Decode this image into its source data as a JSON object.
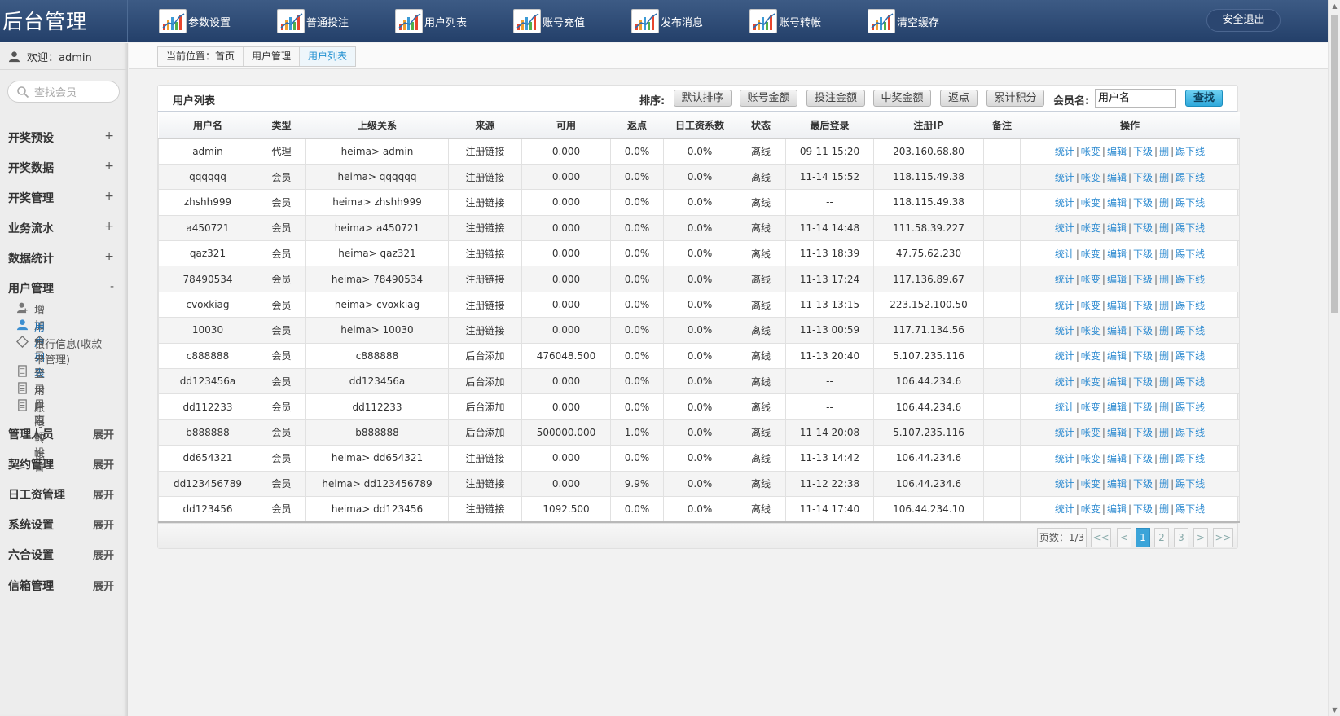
{
  "app": {
    "title": "后台管理",
    "logout_label": "安全退出"
  },
  "nav": [
    {
      "label": "参数设置"
    },
    {
      "label": "普通投注"
    },
    {
      "label": "用户列表"
    },
    {
      "label": "账号充值"
    },
    {
      "label": "发布消息"
    },
    {
      "label": "账号转帐"
    },
    {
      "label": "清空缓存"
    }
  ],
  "sidebar": {
    "welcome": "欢迎：admin",
    "search_placeholder": "查找会员",
    "menus": [
      {
        "label": "开奖预设",
        "sign": "+"
      },
      {
        "label": "开奖数据",
        "sign": "+"
      },
      {
        "label": "开奖管理",
        "sign": "+"
      },
      {
        "label": "业务流水",
        "sign": "+"
      },
      {
        "label": "数据统计",
        "sign": "+"
      },
      {
        "label": "用户管理",
        "sign": "-"
      },
      {
        "label": "管理人员",
        "sign": "展开"
      },
      {
        "label": "契约管理",
        "sign": "展开"
      },
      {
        "label": "日工资管理",
        "sign": "展开"
      },
      {
        "label": "系统设置",
        "sign": "展开"
      },
      {
        "label": "六合设置",
        "sign": "展开"
      },
      {
        "label": "信箱管理",
        "sign": "展开"
      }
    ],
    "user_submenu": [
      {
        "label": "增加会员",
        "icon": "user-add-icon"
      },
      {
        "label": "用户列表",
        "icon": "user-icon"
      },
      {
        "label": "银行信息(收款卡管理)",
        "icon": "diamond-icon"
      },
      {
        "label": "登录日志",
        "icon": "doc-icon"
      },
      {
        "label": "用户限额设置",
        "icon": "doc-icon"
      },
      {
        "label": "账号转帐",
        "icon": "doc-icon"
      }
    ]
  },
  "breadcrumb": {
    "prefix": "当前位置：",
    "home": "首页",
    "section": "用户管理",
    "current": "用户列表"
  },
  "panel": {
    "title": "用户列表",
    "sort_label": "排序:",
    "sort_buttons": [
      "默认排序",
      "账号金额",
      "投注金额",
      "中奖金额",
      "返点",
      "累计积分"
    ],
    "member_label": "会员名:",
    "member_value": "用户名",
    "find_label": "查找"
  },
  "table": {
    "columns": [
      "用户名",
      "类型",
      "上级关系",
      "来源",
      "可用",
      "返点",
      "日工资系数",
      "状态",
      "最后登录",
      "注册IP",
      "备注",
      "操作"
    ],
    "ops": [
      "统计",
      "帐变",
      "编辑",
      "下级",
      "删",
      "踢下线"
    ],
    "rows": [
      [
        "admin",
        "代理",
        "heima> admin",
        "注册链接",
        "0.000",
        "0.0%",
        "0.0%",
        "离线",
        "09-11 15:20",
        "203.160.68.80",
        ""
      ],
      [
        "qqqqqq",
        "会员",
        "heima> qqqqqq",
        "注册链接",
        "0.000",
        "0.0%",
        "0.0%",
        "离线",
        "11-14 15:52",
        "118.115.49.38",
        ""
      ],
      [
        "zhshh999",
        "会员",
        "heima> zhshh999",
        "注册链接",
        "0.000",
        "0.0%",
        "0.0%",
        "离线",
        "--",
        "118.115.49.38",
        ""
      ],
      [
        "a450721",
        "会员",
        "heima> a450721",
        "注册链接",
        "0.000",
        "0.0%",
        "0.0%",
        "离线",
        "11-14 14:48",
        "111.58.39.227",
        ""
      ],
      [
        "qaz321",
        "会员",
        "heima> qaz321",
        "注册链接",
        "0.000",
        "0.0%",
        "0.0%",
        "离线",
        "11-13 18:39",
        "47.75.62.230",
        ""
      ],
      [
        "78490534",
        "会员",
        "heima> 78490534",
        "注册链接",
        "0.000",
        "0.0%",
        "0.0%",
        "离线",
        "11-13 17:24",
        "117.136.89.67",
        ""
      ],
      [
        "cvoxkiag",
        "会员",
        "heima> cvoxkiag",
        "注册链接",
        "0.000",
        "0.0%",
        "0.0%",
        "离线",
        "11-13 13:15",
        "223.152.100.50",
        ""
      ],
      [
        "10030",
        "会员",
        "heima> 10030",
        "注册链接",
        "0.000",
        "0.0%",
        "0.0%",
        "离线",
        "11-13 00:59",
        "117.71.134.56",
        ""
      ],
      [
        "c888888",
        "会员",
        "c888888",
        "后台添加",
        "476048.500",
        "0.0%",
        "0.0%",
        "离线",
        "11-13 20:40",
        "5.107.235.116",
        ""
      ],
      [
        "dd123456a",
        "会员",
        "dd123456a",
        "后台添加",
        "0.000",
        "0.0%",
        "0.0%",
        "离线",
        "--",
        "106.44.234.6",
        ""
      ],
      [
        "dd112233",
        "会员",
        "dd112233",
        "后台添加",
        "0.000",
        "0.0%",
        "0.0%",
        "离线",
        "--",
        "106.44.234.6",
        ""
      ],
      [
        "b888888",
        "会员",
        "b888888",
        "后台添加",
        "500000.000",
        "1.0%",
        "0.0%",
        "离线",
        "11-14 20:08",
        "5.107.235.116",
        ""
      ],
      [
        "dd654321",
        "会员",
        "heima> dd654321",
        "注册链接",
        "0.000",
        "0.0%",
        "0.0%",
        "离线",
        "11-13 14:42",
        "106.44.234.6",
        ""
      ],
      [
        "dd123456789",
        "会员",
        "heima> dd123456789",
        "注册链接",
        "0.000",
        "9.9%",
        "0.0%",
        "离线",
        "11-12 22:38",
        "106.44.234.6",
        ""
      ],
      [
        "dd123456",
        "会员",
        "heima> dd123456",
        "注册链接",
        "1092.500",
        "0.0%",
        "0.0%",
        "离线",
        "11-14 17:40",
        "106.44.234.10",
        ""
      ]
    ]
  },
  "pager": {
    "info": "页数：1/3",
    "first": "<<",
    "prev": "<",
    "pages": [
      "1",
      "2",
      "3"
    ],
    "current_page": "1",
    "next": ">",
    "last": ">>"
  },
  "colors": {
    "topbar": "#2f4d78",
    "accent": "#3ba4d9",
    "link": "#2c8ad0"
  }
}
